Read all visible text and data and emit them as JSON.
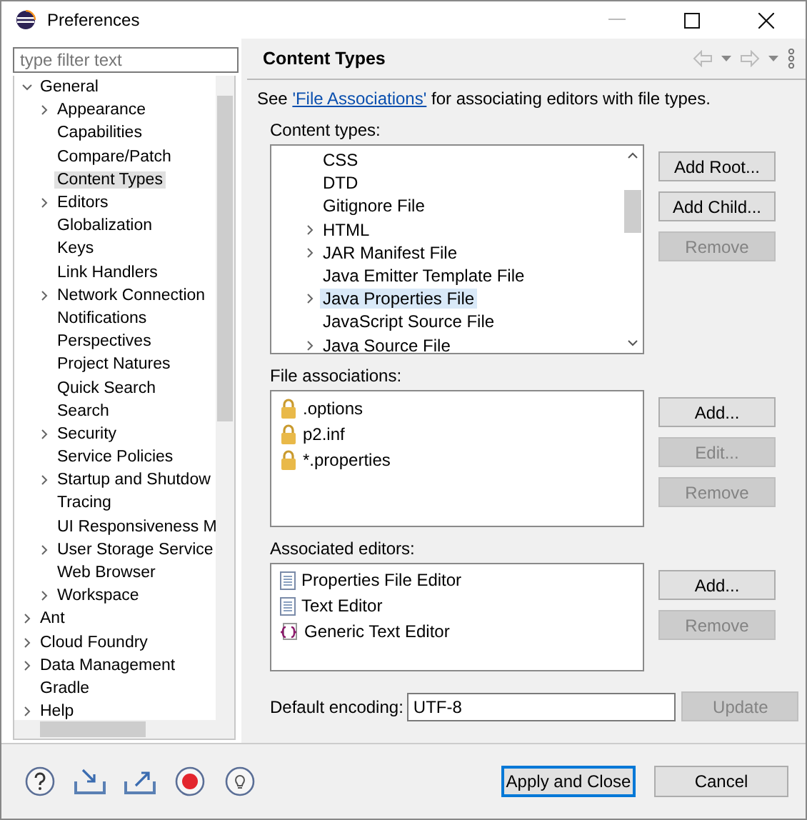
{
  "window": {
    "title": "Preferences"
  },
  "filter": {
    "placeholder": "type filter text"
  },
  "tree": [
    {
      "label": "General",
      "expanded": true,
      "selected": false,
      "children": [
        {
          "label": "Appearance",
          "expanded": false,
          "selected": false
        },
        {
          "label": "Capabilities",
          "selected": false
        },
        {
          "label": "Compare/Patch",
          "selected": false
        },
        {
          "label": "Content Types",
          "selected": true
        },
        {
          "label": "Editors",
          "expanded": false,
          "selected": false
        },
        {
          "label": "Globalization",
          "selected": false
        },
        {
          "label": "Keys",
          "selected": false
        },
        {
          "label": "Link Handlers",
          "selected": false
        },
        {
          "label": "Network Connection",
          "expanded": false,
          "selected": false
        },
        {
          "label": "Notifications",
          "selected": false
        },
        {
          "label": "Perspectives",
          "selected": false
        },
        {
          "label": "Project Natures",
          "selected": false
        },
        {
          "label": "Quick Search",
          "selected": false
        },
        {
          "label": "Search",
          "selected": false
        },
        {
          "label": "Security",
          "expanded": false,
          "selected": false
        },
        {
          "label": "Service Policies",
          "selected": false
        },
        {
          "label": "Startup and Shutdow",
          "expanded": false,
          "selected": false
        },
        {
          "label": "Tracing",
          "selected": false
        },
        {
          "label": "UI Responsiveness M",
          "selected": false
        },
        {
          "label": "User Storage Service",
          "expanded": false,
          "selected": false
        },
        {
          "label": "Web Browser",
          "selected": false
        },
        {
          "label": "Workspace",
          "expanded": false,
          "selected": false
        }
      ]
    },
    {
      "label": "Ant",
      "expanded": false,
      "selected": false
    },
    {
      "label": "Cloud Foundry",
      "expanded": false,
      "selected": false
    },
    {
      "label": "Data Management",
      "expanded": false,
      "selected": false
    },
    {
      "label": "Gradle",
      "selected": false
    },
    {
      "label": "Help",
      "expanded": false,
      "selected": false
    }
  ],
  "page": {
    "title": "Content Types",
    "intro_before": "See ",
    "intro_link": "'File Associations'",
    "intro_after": " for associating editors with file types."
  },
  "content_types": {
    "label": "Content types:",
    "items": [
      {
        "label": "CSS",
        "selected": false
      },
      {
        "label": "DTD",
        "selected": false
      },
      {
        "label": "Gitignore File",
        "selected": false
      },
      {
        "label": "HTML",
        "expanded": false,
        "selected": false
      },
      {
        "label": "JAR Manifest File",
        "expanded": false,
        "selected": false
      },
      {
        "label": "Java Emitter Template File",
        "selected": false
      },
      {
        "label": "Java Properties File",
        "expanded": false,
        "selected": true
      },
      {
        "label": "JavaScript Source File",
        "selected": false
      },
      {
        "label": "Java Source File",
        "expanded": false,
        "selected": false
      }
    ],
    "buttons": [
      {
        "label": "Add Root...",
        "disabled": false
      },
      {
        "label": "Add Child...",
        "disabled": false
      },
      {
        "label": "Remove",
        "disabled": true
      }
    ]
  },
  "file_associations": {
    "label": "File associations:",
    "items": [
      ".options",
      "p2.inf",
      "*.properties"
    ],
    "buttons": [
      {
        "label": "Add...",
        "disabled": false
      },
      {
        "label": "Edit...",
        "disabled": true
      },
      {
        "label": "Remove",
        "disabled": true
      }
    ]
  },
  "associated_editors": {
    "label": "Associated editors:",
    "items": [
      {
        "label": "Properties File Editor",
        "kind": "text"
      },
      {
        "label": "Text Editor",
        "kind": "text"
      },
      {
        "label": "Generic Text Editor",
        "kind": "generic"
      }
    ],
    "buttons": [
      {
        "label": "Add...",
        "disabled": false
      },
      {
        "label": "Remove",
        "disabled": true
      }
    ]
  },
  "encoding": {
    "label": "Default encoding:",
    "value": "UTF-8",
    "button": {
      "label": "Update",
      "disabled": true
    }
  },
  "footer_buttons": [
    {
      "label": "Apply and Close",
      "default": true
    },
    {
      "label": "Cancel",
      "default": false
    }
  ]
}
